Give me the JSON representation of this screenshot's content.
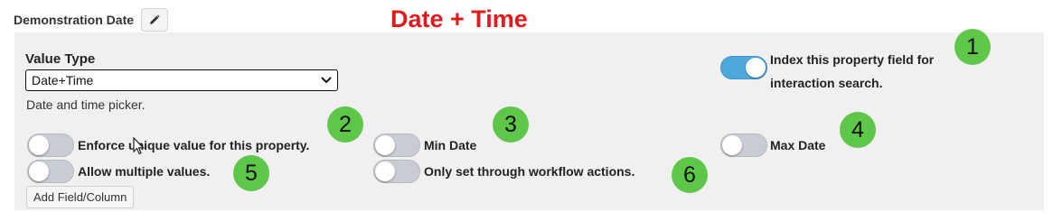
{
  "property": {
    "name": "Demonstration Date",
    "edit_icon": "pencil-icon"
  },
  "annotation": {
    "title": "Date + Time"
  },
  "value_type": {
    "label": "Value Type",
    "selected": "Date+Time",
    "helper": "Date and time picker."
  },
  "options": {
    "index": {
      "label": "Index this property field for interaction search.",
      "on": true
    },
    "unique": {
      "label": "Enforce unique value for this property.",
      "on": false
    },
    "min_date": {
      "label": "Min Date",
      "on": false
    },
    "max_date": {
      "label": "Max Date",
      "on": false
    },
    "multiple": {
      "label": "Allow multiple values.",
      "on": false
    },
    "workflow_only": {
      "label": "Only set through workflow actions.",
      "on": false
    }
  },
  "add_field_label": "Add Field/Column",
  "badges": [
    "1",
    "2",
    "3",
    "4",
    "5",
    "6"
  ],
  "colors": {
    "annotation_red": "#e11b1b",
    "badge_green": "#5ec74a",
    "toggle_on": "#4fa8dc",
    "panel_bg": "#f0f0f0"
  }
}
